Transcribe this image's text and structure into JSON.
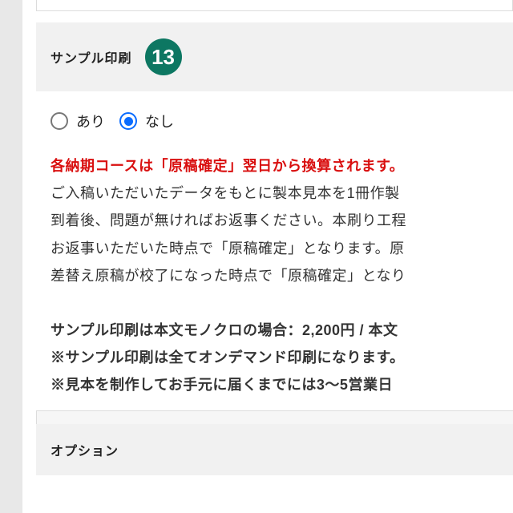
{
  "section": {
    "title": "サンプル印刷",
    "step_number": "13"
  },
  "options": {
    "yes": "あり",
    "no": "なし",
    "selected": "no"
  },
  "description": {
    "warning": "各納期コースは「原稿確定」翌日から換算されます。",
    "line1": "ご入稿いただいたデータをもとに製本見本を1冊作製",
    "line2": "到着後、問題が無ければお返事ください。本刷り工程",
    "line3": "お返事いただいた時点で「原稿確定」となります。原",
    "line4": "差替え原稿が校了になった時点で「原稿確定」となり",
    "price": "サンプル印刷は本文モノクロの場合：2,200円 / 本文",
    "note1": "※サンプル印刷は全てオンデマンド印刷になります。",
    "note2": "※見本を制作してお手元に届くまでには3〜5営業日"
  },
  "next_section": {
    "title_fragment": "オプション"
  }
}
